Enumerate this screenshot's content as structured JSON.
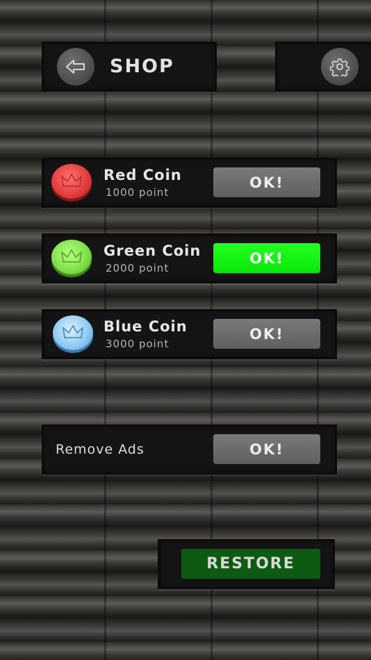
{
  "header": {
    "title": "SHOP",
    "back_icon": "back-arrow-icon",
    "settings_icon": "gear-icon"
  },
  "items": [
    {
      "name": "Red Coin",
      "price": "1000 point",
      "button": "OK!",
      "color": "#e84545",
      "selected": false
    },
    {
      "name": "Green Coin",
      "price": "2000 point",
      "button": "OK!",
      "color": "#7fe04a",
      "selected": true
    },
    {
      "name": "Blue Coin",
      "price": "3000 point",
      "button": "OK!",
      "color": "#8cc8f2",
      "selected": false
    }
  ],
  "remove_ads": {
    "label": "Remove Ads",
    "button": "OK!"
  },
  "restore": {
    "label": "RESTORE"
  },
  "colors": {
    "active_button": "#11f211",
    "inactive_button": "#6b6b6b",
    "restore_button": "#0d5a12"
  }
}
